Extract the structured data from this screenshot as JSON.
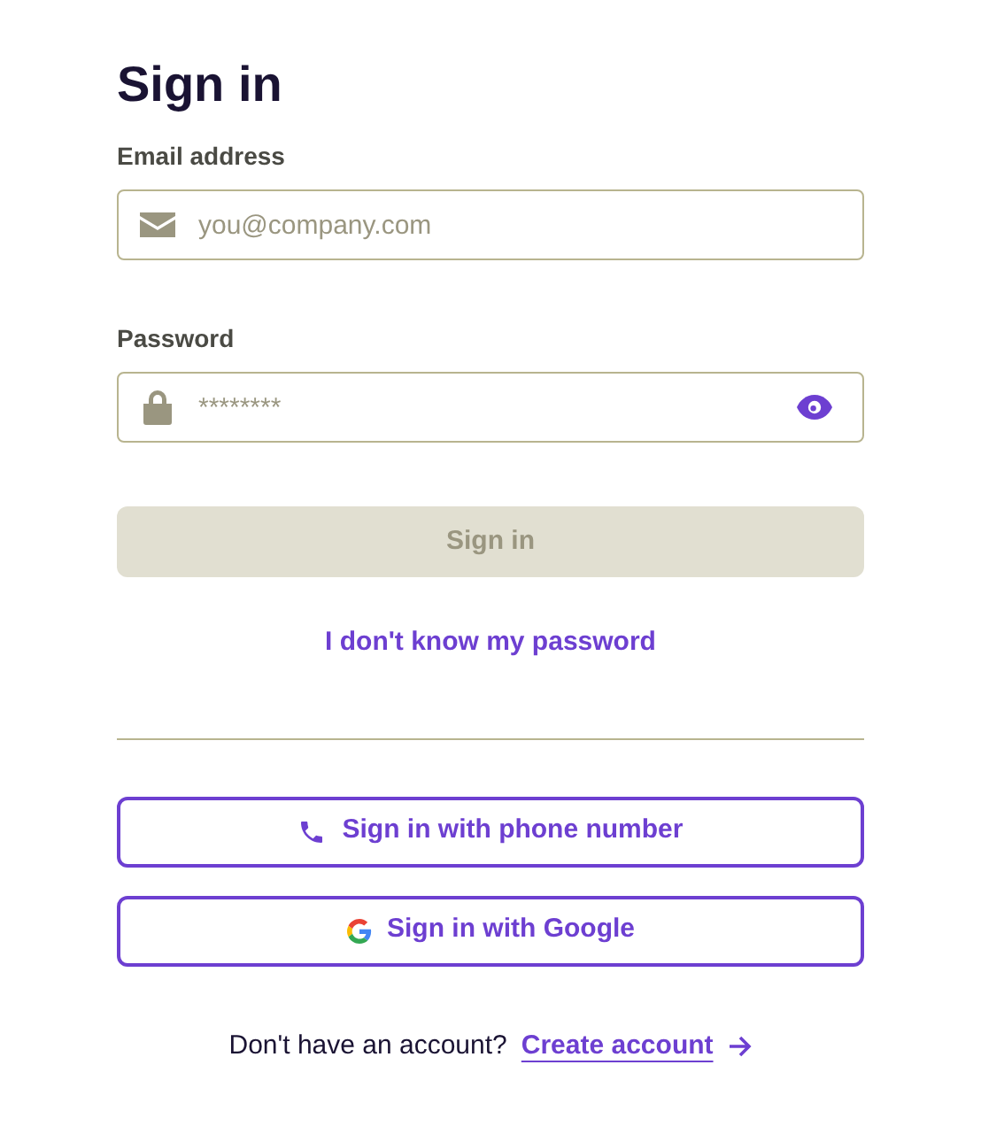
{
  "title": "Sign in",
  "email": {
    "label": "Email address",
    "placeholder": "you@company.com"
  },
  "password": {
    "label": "Password",
    "placeholder": "********"
  },
  "submit": {
    "label": "Sign in",
    "disabled": true
  },
  "forgot_link": "I don't know my password",
  "alt_buttons": [
    {
      "kind": "phone",
      "label": "Sign in with phone number"
    },
    {
      "kind": "google",
      "label": "Sign in with Google"
    }
  ],
  "footer": {
    "text": "Don't have an account?",
    "link": "Create account"
  }
}
